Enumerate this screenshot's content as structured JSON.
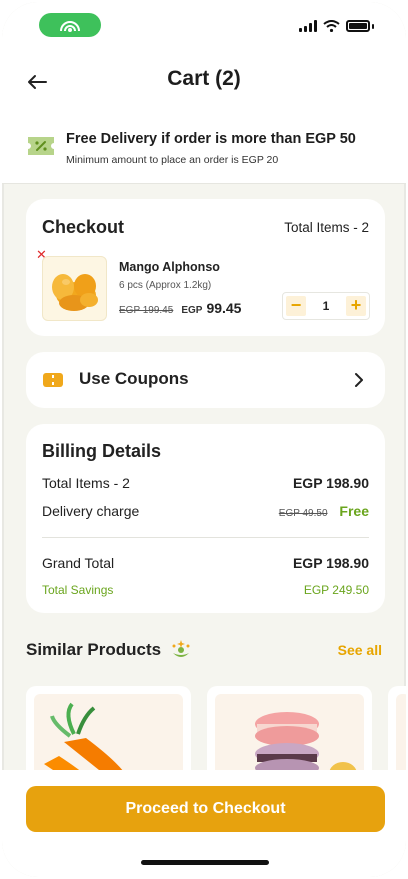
{
  "header": {
    "title": "Cart (2)"
  },
  "banner": {
    "title": "Free Delivery if order is more than EGP 50",
    "subtitle": "Minimum amount to place an order is EGP 20"
  },
  "checkout": {
    "title": "Checkout",
    "total_items": "Total Items - 2",
    "item": {
      "name": "Mango Alphonso",
      "desc": "6 pcs (Approx 1.2kg)",
      "old_price": "EGP 199.45",
      "currency": "EGP",
      "price": "99.45",
      "quantity": "1"
    }
  },
  "coupons": {
    "label": "Use Coupons"
  },
  "billing": {
    "title": "Billing Details",
    "rows": [
      {
        "label": "Total Items - 2",
        "value": "EGP 198.90"
      },
      {
        "label": "Delivery charge",
        "old_value": "EGP 49.50",
        "value": "Free"
      },
      {
        "label": "Grand Total",
        "value": "EGP 198.90"
      },
      {
        "label": "Total Savings",
        "value": "EGP 249.50"
      }
    ]
  },
  "similar": {
    "title": "Similar Products",
    "see_all": "See all"
  },
  "cta": {
    "label": "Proceed to Checkout"
  },
  "colors": {
    "accent": "#e7a20e",
    "green": "#6aa51d",
    "status_pill": "#3ec15b"
  }
}
